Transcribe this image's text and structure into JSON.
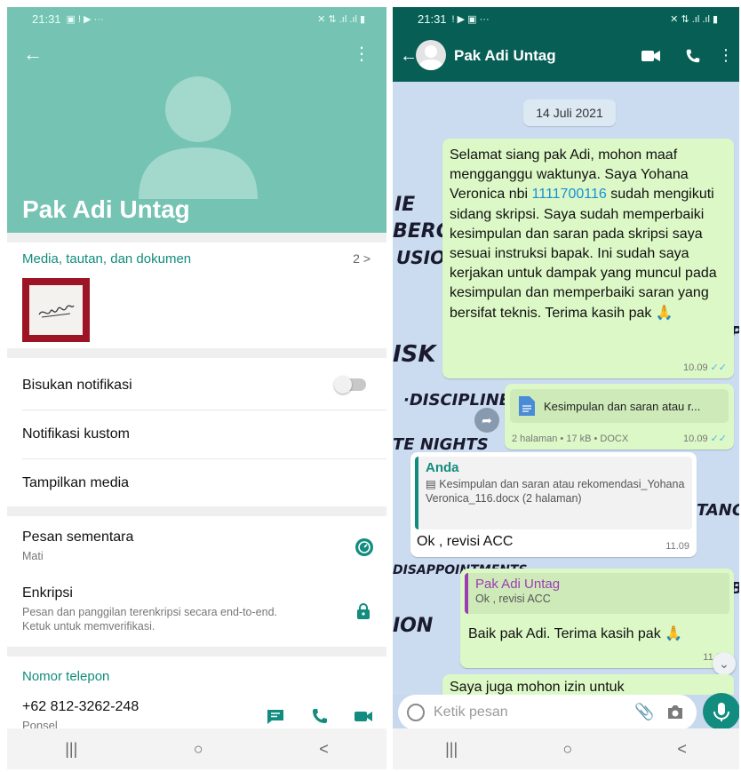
{
  "left": {
    "status_time": "21:31",
    "status_icons_left": "▣ ! ▶ ···",
    "status_icons_right": "✕ ⇅ .ıl .ıl ▮",
    "contact_name": "Pak Adi Untag",
    "media_title": "Media, tautan, dan dokumen",
    "media_count": "2 >",
    "mute_label": "Bisukan notifikasi",
    "custom_notif_label": "Notifikasi kustom",
    "show_media_label": "Tampilkan media",
    "disappearing_label": "Pesan sementara",
    "disappearing_value": "Mati",
    "encryption_label": "Enkripsi",
    "encryption_desc_1": "Pesan dan panggilan terenkripsi secara end-to-end.",
    "encryption_desc_2": "Ketuk untuk memverifikasi.",
    "phone_title": "Nomor telepon",
    "phone_number": "+62 812-3262-248",
    "phone_type": "Ponsel",
    "nav": [
      "|||",
      "○",
      "<"
    ]
  },
  "right": {
    "status_time": "21:31",
    "status_icons_left": "! ▶ ▣ ···",
    "status_icons_right": "✕ ⇅ .ıl .ıl ▮",
    "chat_name": "Pak Adi Untag",
    "date_chip": "14 Juli 2021",
    "msg1_text_a": "Selamat siang pak Adi, mohon maaf mengganggu waktunya. Saya Yohana Veronica nbi ",
    "msg1_phone": "1111700116",
    "msg1_text_b": " sudah mengikuti sidang skripsi. Saya sudah memperbaiki kesimpulan dan saran pada skripsi saya sesuai instruksi bapak. Ini sudah saya kerjakan untuk dampak yang muncul pada kesimpulan dan memperbaiki saran yang bersifat teknis. Terima kasih pak 🙏",
    "msg1_time": "10.09",
    "doc_name": "Kesimpulan dan saran atau r...",
    "doc_meta": "2 halaman • 17 kB • DOCX",
    "doc_time": "10.09",
    "msg3_quote_author": "Anda",
    "msg3_quote_text": "▤ Kesimpulan dan saran atau rekomendasi_Yohana Veronica_116.docx (2 halaman)",
    "msg3_text": "Ok , revisi ACC",
    "msg3_time": "11.09",
    "msg4_quote_author": "Pak Adi Untag",
    "msg4_quote_text": "Ok , revisi ACC",
    "msg4_text": "Baik pak Adi. Terima kasih pak 🙏",
    "msg4_time": "11.12",
    "msg5_text": "Saya juga mohon izin untuk",
    "input_placeholder": "Ketik pesan",
    "ticks": "✓✓",
    "doodles": [
      "IE",
      "BERG",
      "USIO",
      "ISK A",
      "·DISCIPLINE",
      "TE NIGHTS",
      "DISAPPOINTMENTS",
      "ION",
      "TANCE",
      "P",
      "B"
    ],
    "nav": [
      "|||",
      "○",
      "<"
    ]
  },
  "colors": {
    "header_teal": "#74c3b3",
    "whatsapp_dark": "#075e54",
    "whatsapp_green": "#128c7e",
    "bubble_out": "#dcf8c6",
    "link_blue": "#1a8fd8"
  }
}
